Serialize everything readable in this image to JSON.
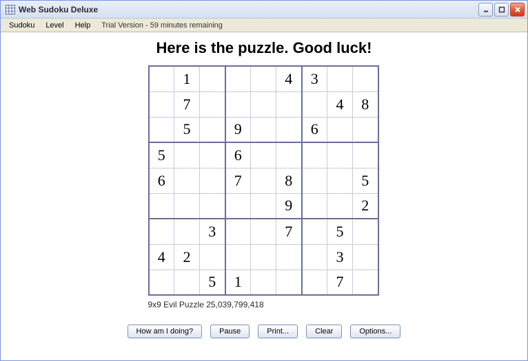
{
  "window": {
    "title": "Web Sudoku Deluxe"
  },
  "menu": {
    "sudoku": "Sudoku",
    "level": "Level",
    "help": "Help",
    "trial": "Trial Version - 59 minutes remaining"
  },
  "heading": "Here is the puzzle. Good luck!",
  "puzzle_info": "9x9 Evil Puzzle 25,039,799,418",
  "buttons": {
    "how": "How am I doing?",
    "pause": "Pause",
    "print": "Print...",
    "clear": "Clear",
    "options": "Options..."
  },
  "grid": [
    [
      "",
      "1",
      "",
      "",
      "",
      "4",
      "3",
      "",
      ""
    ],
    [
      "",
      "7",
      "",
      "",
      "",
      "",
      "",
      "4",
      "8"
    ],
    [
      "",
      "5",
      "",
      "9",
      "",
      "",
      "6",
      "",
      ""
    ],
    [
      "5",
      "",
      "",
      "6",
      "",
      "",
      "",
      "",
      ""
    ],
    [
      "6",
      "",
      "",
      "7",
      "",
      "8",
      "",
      "",
      "5"
    ],
    [
      "",
      "",
      "",
      "",
      "",
      "9",
      "",
      "",
      "2"
    ],
    [
      "",
      "",
      "3",
      "",
      "",
      "7",
      "",
      "5",
      ""
    ],
    [
      "4",
      "2",
      "",
      "",
      "",
      "",
      "",
      "3",
      ""
    ],
    [
      "",
      "",
      "5",
      "1",
      "",
      "",
      "",
      "7",
      ""
    ]
  ]
}
